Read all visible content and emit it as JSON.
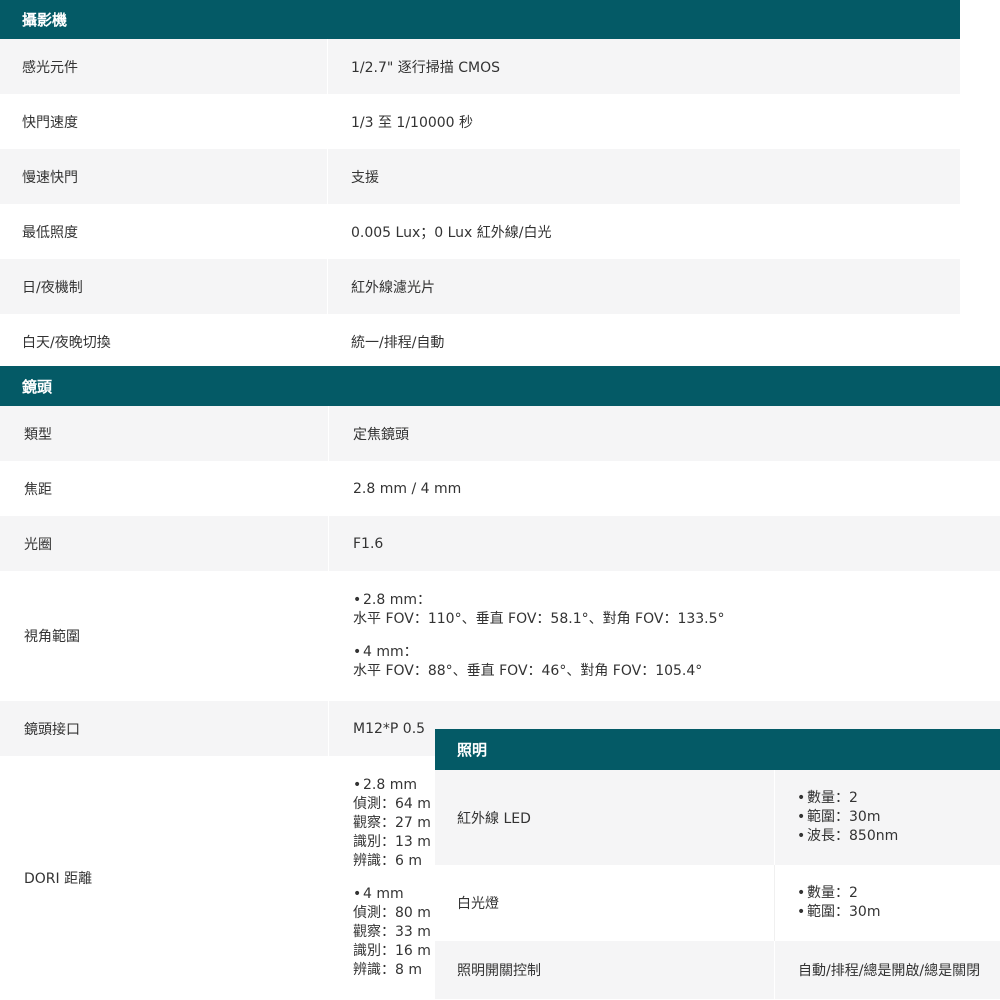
{
  "camera": {
    "header": "攝影機",
    "rows": [
      {
        "label": "感光元件",
        "value": "1/2.7\" 逐行掃描 CMOS"
      },
      {
        "label": "快門速度",
        "value": "1/3 至 1/10000 秒"
      },
      {
        "label": "慢速快門",
        "value": "支援"
      },
      {
        "label": "最低照度",
        "value": "0.005 Lux；0 Lux 紅外線/白光"
      },
      {
        "label": "日/夜機制",
        "value": "紅外線濾光片"
      },
      {
        "label": "白天/夜晚切換",
        "value": "統一/排程/自動"
      }
    ]
  },
  "lens": {
    "header": "鏡頭",
    "rows": [
      {
        "label": "類型",
        "value": "定焦鏡頭"
      },
      {
        "label": "焦距",
        "value": "2.8 mm / 4 mm"
      },
      {
        "label": "光圈",
        "value": "F1.6"
      }
    ],
    "fov": {
      "label": "視角範圍",
      "groups": [
        {
          "bullet": "•",
          "title": "2.8 mm：",
          "detail": "水平 FOV：110°、垂直 FOV：58.1°、對角 FOV：133.5°"
        },
        {
          "bullet": "•",
          "title": "4 mm：",
          "detail": "水平 FOV：88°、垂直 FOV：46°、對角 FOV：105.4°"
        }
      ]
    },
    "mount": {
      "label": "鏡頭接口",
      "value": "M12*P 0.5"
    },
    "dori": {
      "label": "DORI 距離",
      "groups": [
        {
          "bullet": "•",
          "title": "2.8 mm",
          "lines": [
            "偵測：64 m",
            "觀察：27 m",
            "識別：13 m",
            "辨識：6 m"
          ]
        },
        {
          "bullet": "•",
          "title": "4 mm",
          "lines": [
            "偵測：80 m",
            "觀察：33 m",
            "識別：16 m",
            "辨識：8 m"
          ]
        }
      ]
    }
  },
  "lighting": {
    "header": "照明",
    "ir": {
      "label": "紅外線 LED",
      "bullet": "•",
      "items": [
        "數量：2",
        "範圍：30m",
        "波長：850nm"
      ]
    },
    "white": {
      "label": "白光燈",
      "bullet": "•",
      "items": [
        "數量：2",
        "範圍：30m"
      ]
    },
    "control": {
      "label": "照明開關控制",
      "value": "自動/排程/總是開啟/總是關閉"
    }
  },
  "colors": {
    "header_bg": "#045a66",
    "row_alt": "#f5f5f6",
    "text": "#333333"
  }
}
